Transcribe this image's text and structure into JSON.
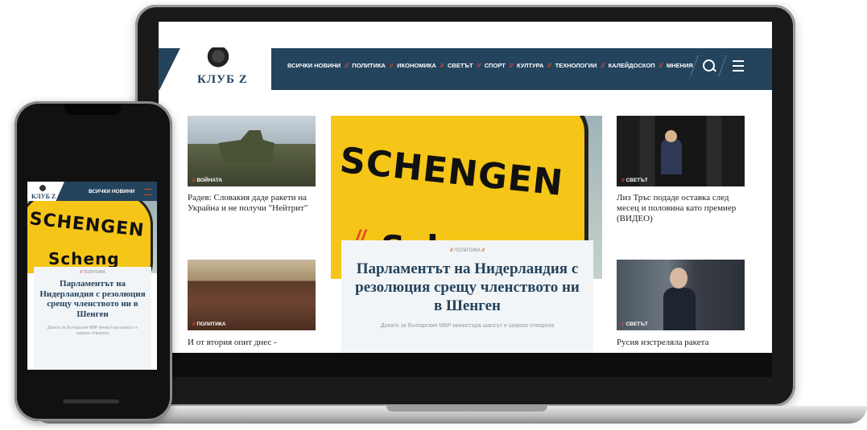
{
  "site": {
    "logo_text": "КЛУБ Z",
    "nav": [
      "ВСИЧКИ НОВИНИ",
      "ПОЛИТИКА",
      "ИКОНОМИКА",
      "СВЕТЪТ",
      "СПОРТ",
      "КУЛТУРА",
      "ТЕХНОЛОГИИ",
      "КАЛЕЙДОСКОП",
      "МНЕНИЯ"
    ],
    "nav_separator": "//"
  },
  "featured": {
    "sign_line1": "SCHENGEN",
    "sign_line2": "Scheng",
    "tag": "ПОЛИТИКА",
    "title": "Парламентът на Нидерландия с резолюция срещу членството ни в Шенген",
    "excerpt": "Докато за българския МВР министъра шансът е широко отворена"
  },
  "cards": [
    {
      "tag": "ВОЙНАТА",
      "title": "Радев: Словакия даде ракети на Украйна и не получи \"Нейтрит\""
    },
    {
      "tag": "СВЕТЪТ",
      "title": "Лиз Тръс подаде оставка след месец и половина като премиер (ВИДЕО)"
    },
    {
      "tag": "ПОЛИТИКА",
      "title": "И от втория опит днес -"
    },
    {
      "tag": "СВЕТЪТ",
      "title": "Русия изстреляла ракета"
    }
  ],
  "phone": {
    "nav_label": "ВСИЧКИ НОВИНИ",
    "tag": "ПОЛИТИКА",
    "title": "Парламентът на Нидерландия с резолюция срещу членството ни в Шенген",
    "excerpt": "Докато за българския МВР министъра шансът е широко отворена"
  },
  "colors": {
    "brand": "#24435d",
    "accent": "#e04a2a",
    "sign": "#f5c518"
  }
}
